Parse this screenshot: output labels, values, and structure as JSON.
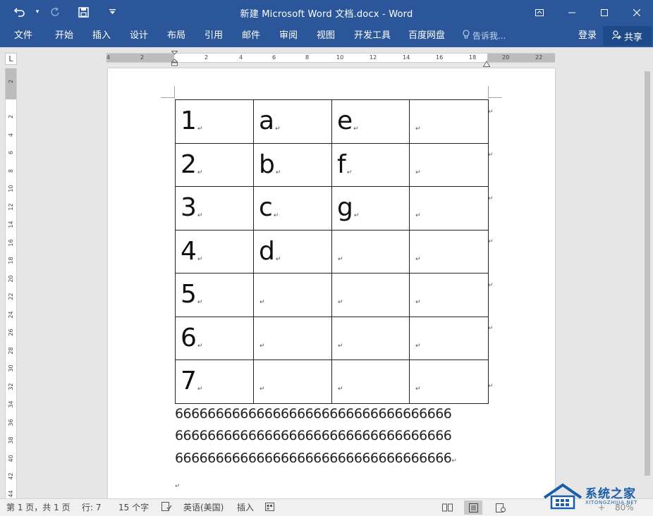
{
  "titlebar": {
    "title": "新建 Microsoft Word 文档.docx - Word",
    "undo_icon": "undo-icon",
    "redo_icon": "redo-icon",
    "save_icon": "save-icon",
    "customize_icon": "qat-dropdown-icon"
  },
  "ribbon": {
    "tabs": [
      "文件",
      "开始",
      "插入",
      "设计",
      "布局",
      "引用",
      "邮件",
      "审阅",
      "视图",
      "开发工具",
      "百度网盘"
    ],
    "tell_me": "告诉我...",
    "sign_in": "登录",
    "share": "共享"
  },
  "ruler": {
    "corner": "L",
    "h_numbers": [
      "4",
      "2",
      "2",
      "4",
      "6",
      "8",
      "10",
      "12",
      "14",
      "16",
      "18",
      "20",
      "22"
    ],
    "v_numbers": [
      "2",
      "2",
      "4",
      "6",
      "8",
      "10",
      "12",
      "14",
      "16",
      "18",
      "20",
      "22",
      "24",
      "26",
      "28",
      "30",
      "32",
      "34",
      "36",
      "38",
      "40",
      "42",
      "44"
    ]
  },
  "document": {
    "table": [
      [
        "1",
        "a",
        "e",
        ""
      ],
      [
        "2",
        "b",
        "f",
        ""
      ],
      [
        "3",
        "c",
        "g",
        ""
      ],
      [
        "4",
        "d",
        "",
        ""
      ],
      [
        "5",
        "",
        "",
        ""
      ],
      [
        "6",
        "",
        "",
        ""
      ],
      [
        "7",
        "",
        "",
        ""
      ]
    ],
    "paragraph_lines": [
      "6666666666666666666666666666666666",
      "6666666666666666666666666666666666",
      "6666666666666666666666666666666666"
    ],
    "paragraph_mark": "↵"
  },
  "statusbar": {
    "page": "第 1 页，共 1 页",
    "row": "行: 7",
    "words": "15 个字",
    "language": "英语(美国)",
    "mode": "插入",
    "zoom": "80%"
  },
  "watermark": {
    "brand": "系统之家",
    "sub": "XITONGZHIJIA.NET"
  },
  "colors": {
    "word_blue": "#2b579a",
    "status_bg": "#f0f0f0"
  }
}
